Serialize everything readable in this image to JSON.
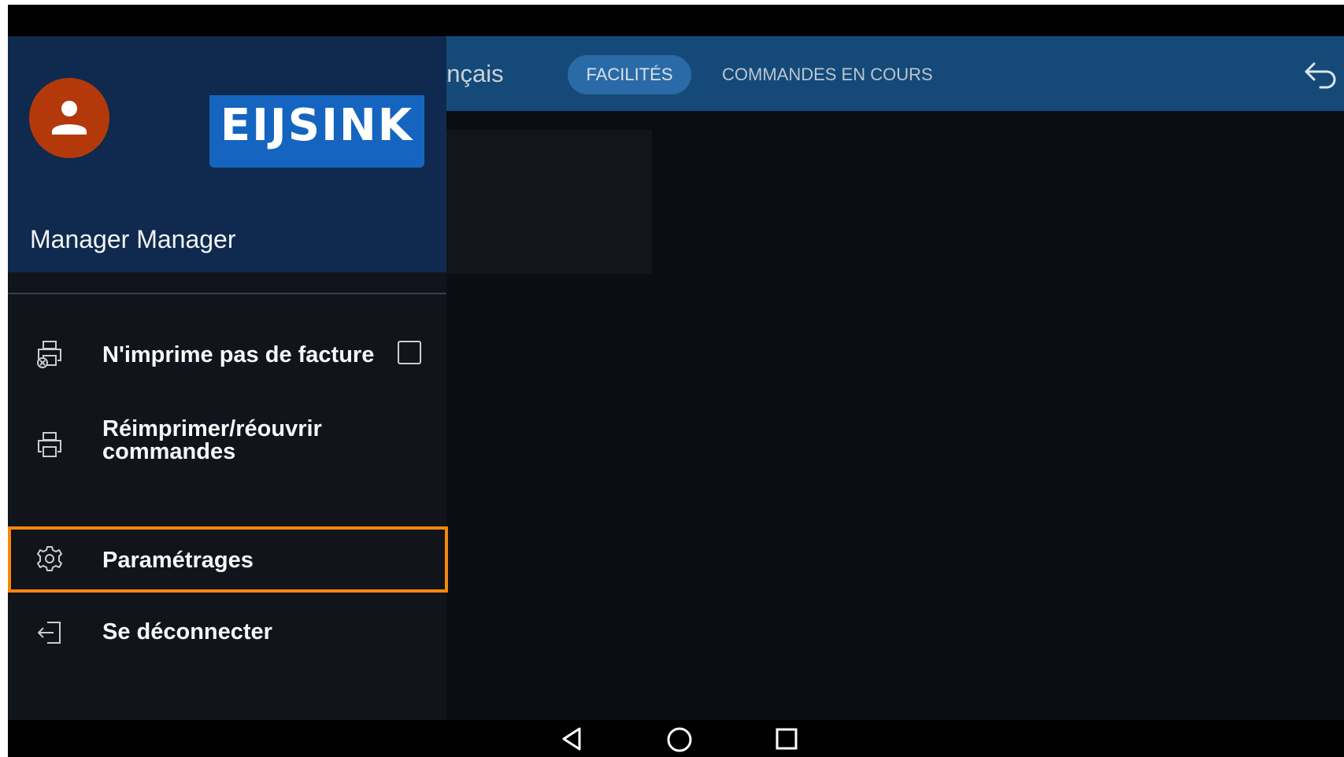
{
  "topbar": {
    "title": "ançais",
    "tabs": [
      {
        "label": "FACILITÉS",
        "active": true
      },
      {
        "label": "COMMANDES EN COURS",
        "active": false
      }
    ],
    "back_icon": "undo-arrow-icon"
  },
  "drawer": {
    "avatar_icon": "person-icon",
    "logo_text": "EIJSINK",
    "user_name": "Manager Manager",
    "items": [
      {
        "label": "N'imprime pas de facture",
        "icon": "printer-cancel-icon",
        "checkbox": false
      },
      {
        "label": "Réimprimer/réouvrir commandes",
        "icon": "printer-icon"
      },
      {
        "label": "Paramétrages",
        "icon": "gear-icon",
        "highlighted": true
      },
      {
        "label": "Se déconnecter",
        "icon": "logout-icon"
      }
    ]
  },
  "navbar": {
    "buttons": [
      "back-triangle-icon",
      "home-circle-icon",
      "recents-square-icon"
    ]
  },
  "colors": {
    "topbar": "#154a78",
    "drawer_header": "#0f2a4e",
    "avatar": "#b3390b",
    "logo": "#1565c0",
    "highlight": "#f5870c"
  }
}
